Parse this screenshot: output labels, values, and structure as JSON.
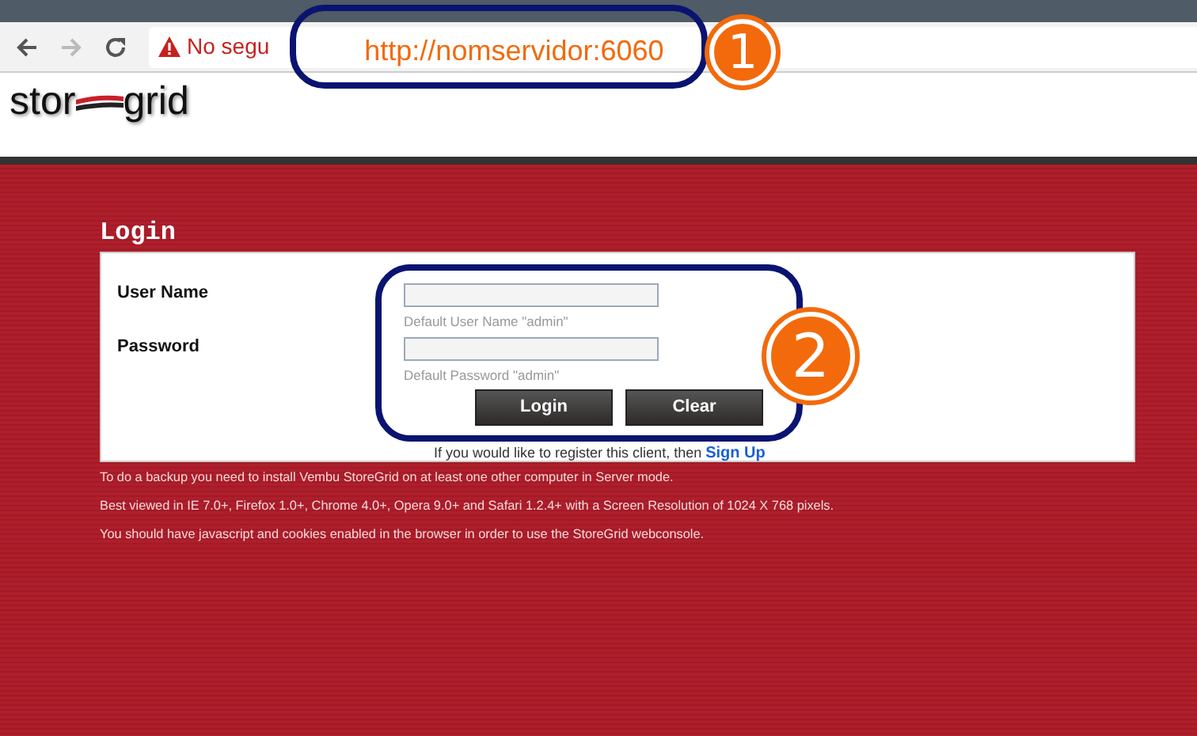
{
  "browser": {
    "security_label": "No segu",
    "url_annotation": "http://nomservidor:6060"
  },
  "logo": {
    "left": "stor",
    "right": "grid"
  },
  "login": {
    "title": "Login",
    "fields": [
      {
        "label": "User Name",
        "hint": "Default User Name \"admin\""
      },
      {
        "label": "Password",
        "hint": "Default Password \"admin\""
      }
    ],
    "buttons": [
      "Login",
      "Clear"
    ],
    "register_text": "If you would like to register this client, then",
    "register_link": "Sign Up"
  },
  "notes": [
    "To do a backup you need to install Vembu StoreGrid on at least one other computer in Server mode.",
    "Best viewed in IE 7.0+, Firefox 1.0+, Chrome 4.0+, Opera 9.0+ and Safari 1.2.4+ with a Screen Resolution of 1024 X 768 pixels.",
    "You should have javascript and cookies enabled in the browser in order to use the StoreGrid webconsole."
  ],
  "callouts": [
    "1",
    "2"
  ]
}
